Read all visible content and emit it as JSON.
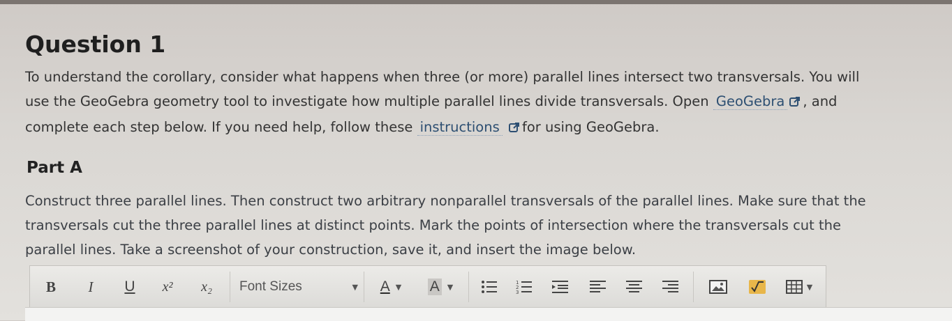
{
  "question": {
    "title": "Question 1",
    "intro_1": "To understand the corollary, consider what happens when three (or more) parallel lines intersect two transversals. You will",
    "intro_2a": "use the GeoGebra geometry tool to investigate how multiple parallel lines divide transversals. Open",
    "link_geogebra": "GeoGebra",
    "intro_2b": ", and",
    "intro_3a": "complete each step below. If you need help, follow these",
    "link_instructions": "instructions",
    "intro_3b": "for using GeoGebra."
  },
  "part_a": {
    "title": "Part A",
    "line_1": "Construct three parallel lines. Then construct two arbitrary nonparallel transversals of the parallel lines. Make sure that the",
    "line_2": "transversals cut the three parallel lines at distinct points. Mark the points of intersection where the transversals cut the",
    "line_3": "parallel lines. Take a screenshot of your construction, save it, and insert the image below."
  },
  "toolbar": {
    "bold": "B",
    "italic": "I",
    "underline": "U",
    "superscript": "x²",
    "subscript": "x₂",
    "font_sizes": "Font Sizes",
    "font_color": "A",
    "background_color": "A"
  },
  "icons": [
    "external-link-icon",
    "bullet-list-icon",
    "numbered-list-icon",
    "indent-icon",
    "align-left-icon",
    "align-center-icon",
    "align-right-icon",
    "insert-image-icon",
    "math-icon",
    "table-icon",
    "dropdown-caret-icon"
  ]
}
